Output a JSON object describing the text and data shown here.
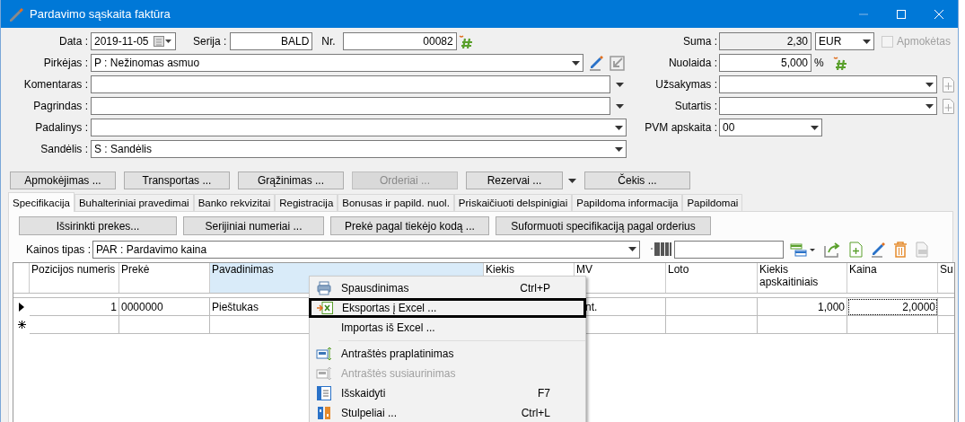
{
  "window": {
    "title": "Pardavimo sąskaita faktūra"
  },
  "date": {
    "label": "Data :",
    "value": "2019-11-05"
  },
  "series": {
    "label": "Serija :",
    "value": "BALD"
  },
  "number": {
    "label": "Nr.",
    "value": "00082"
  },
  "left_fields": [
    {
      "label": "Pirkėjas :",
      "value": "P : Nežinomas asmuo",
      "kind": "buyer"
    },
    {
      "label": "Komentaras :",
      "kind": "outer_combo"
    },
    {
      "label": "Pagrindas :",
      "kind": "outer_combo"
    },
    {
      "label": "Padalinys :",
      "kind": "combo"
    },
    {
      "label": "Sandėlis :",
      "value": "S : Sandėlis",
      "kind": "combo"
    }
  ],
  "sum": {
    "label": "Suma :",
    "value": "2,30",
    "currency": "EUR",
    "paid_label": "Apmokėtas",
    "paid": false,
    "paid_disabled": true
  },
  "discount": {
    "label": "Nuolaida :",
    "value": "5,000",
    "unit": "%"
  },
  "right_fields": [
    {
      "label": "Užsakymas :",
      "kind": "add_combo"
    },
    {
      "label": "Sutartis :",
      "kind": "add_combo"
    },
    {
      "label": "PVM apskaita :",
      "value": "00",
      "kind": "short_combo"
    }
  ],
  "action_buttons": [
    {
      "label": "Apmokėjimas ...",
      "disabled": false,
      "dropdown": false
    },
    {
      "label": "Transportas ...",
      "disabled": false,
      "dropdown": false
    },
    {
      "label": "Grąžinimas ...",
      "disabled": false,
      "dropdown": false
    },
    {
      "label": "Orderiai ...",
      "disabled": true,
      "dropdown": false
    },
    {
      "label": "Rezervai ...",
      "disabled": false,
      "dropdown": true
    },
    {
      "label": "Čekis ...",
      "disabled": false,
      "dropdown": false
    }
  ],
  "tabs": [
    {
      "label": "Specifikacija",
      "selected": true
    },
    {
      "label": "Buhalteriniai pravedimai",
      "selected": false
    },
    {
      "label": "Banko rekvizitai",
      "selected": false
    },
    {
      "label": "Registracija",
      "selected": false
    },
    {
      "label": "Bonusas ir papild. nuol.",
      "selected": false
    },
    {
      "label": "Priskaičiuoti delspinigiai",
      "selected": false
    },
    {
      "label": "Papildoma informacija",
      "selected": false
    },
    {
      "label": "Papildomai",
      "selected": false
    }
  ],
  "spec_buttons": [
    "Išsirinkti prekes...",
    "Serijiniai numeriai ...",
    "Prekė pagal tiekėjo kodą ...",
    "Suformuoti specifikaciją pagal orderius"
  ],
  "price_type": {
    "label": "Kainos tipas :",
    "value": "PAR : Pardavimo kaina"
  },
  "table": {
    "columns": [
      {
        "label": "Pozicijos numeris",
        "highlighted": false
      },
      {
        "label": "Prekė",
        "highlighted": false
      },
      {
        "label": "Pavadinimas",
        "highlighted": true
      },
      {
        "label": "Kiekis",
        "highlighted": false
      },
      {
        "label": "MV",
        "highlighted": false
      },
      {
        "label": "Loto",
        "highlighted": false
      },
      {
        "label": "Kiekis apskaitiniais",
        "highlighted": false
      },
      {
        "label": "Kaina",
        "highlighted": false
      },
      {
        "label": "Su",
        "highlighted": false
      }
    ],
    "rows": [
      {
        "kind": "current",
        "cells": [
          {
            "text": "1",
            "focused": false
          },
          {
            "text": "0000000",
            "focused": false
          },
          {
            "text": "Pieštukas",
            "focused": false
          },
          null,
          {
            "text": "nt.",
            "focused": false
          },
          {
            "text": "",
            "focused": false
          },
          {
            "text": "1,000",
            "focused": false
          },
          {
            "text": "2,0000",
            "focused": true
          },
          {
            "text": "",
            "focused": false
          }
        ]
      },
      {
        "kind": "new",
        "cells": [
          {
            "text": "",
            "focused": false
          },
          {
            "text": "",
            "focused": false
          },
          {
            "text": "",
            "focused": false
          },
          null,
          {
            "text": "",
            "focused": false
          },
          {
            "text": "",
            "focused": false
          },
          {
            "text": "",
            "focused": false
          },
          {
            "text": "",
            "focused": false
          },
          {
            "text": "",
            "focused": false
          }
        ]
      }
    ]
  },
  "context_menu": {
    "items": [
      {
        "kind": "item",
        "label": "Spausdinimas",
        "shortcut": "Ctrl+P",
        "disabled": false,
        "highlighted": false
      },
      {
        "kind": "item",
        "label": "Eksportas į Excel ...",
        "disabled": false,
        "highlighted": true
      },
      {
        "kind": "item",
        "label": "Importas iš Excel ...",
        "disabled": false,
        "highlighted": false
      },
      {
        "kind": "separator"
      },
      {
        "kind": "item",
        "label": "Antraštės praplatinimas",
        "disabled": false,
        "highlighted": false
      },
      {
        "kind": "item",
        "label": "Antraštės susiaurinimas",
        "disabled": true,
        "highlighted": false
      },
      {
        "kind": "item",
        "label": "Išskaidyti",
        "shortcut": "F7",
        "disabled": false,
        "highlighted": false
      },
      {
        "kind": "item",
        "label": "Stulpeliai ...",
        "shortcut": "Ctrl+L",
        "disabled": false,
        "highlighted": false
      }
    ]
  }
}
